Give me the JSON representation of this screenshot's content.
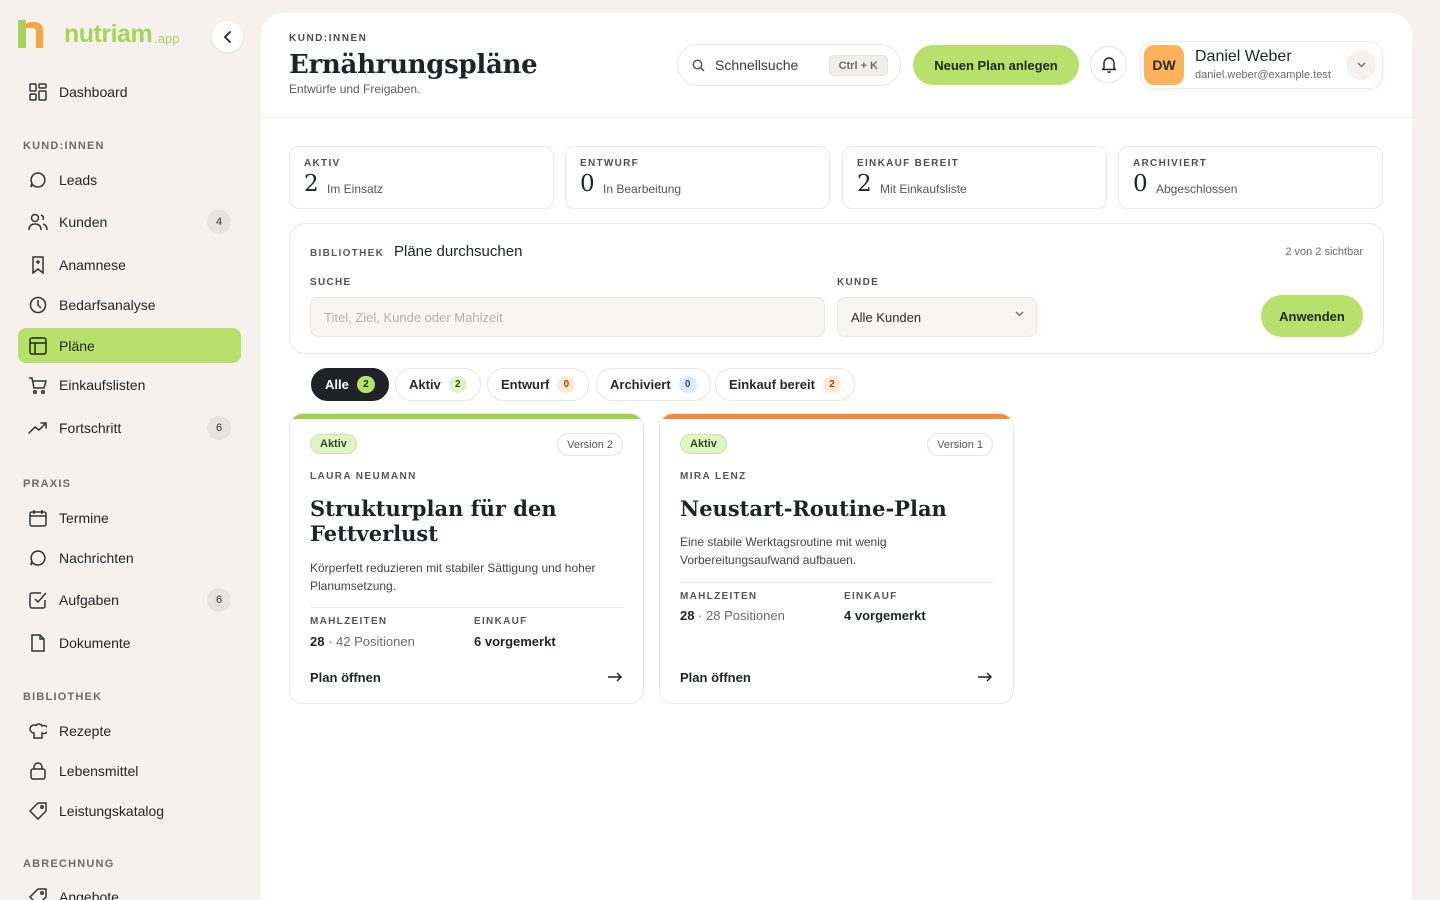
{
  "app": {
    "logo_text": "nutriam",
    "logo_suffix": ".app"
  },
  "sidebar": {
    "dashboard": "Dashboard",
    "sections": {
      "clients": "KUND:INNEN",
      "practice": "PRAXIS",
      "library": "BIBLIOTHEK",
      "billing": "ABRECHNUNG"
    },
    "items": [
      {
        "label": "Leads"
      },
      {
        "label": "Kunden",
        "badge": "4"
      },
      {
        "label": "Anamnese"
      },
      {
        "label": "Bedarfsanalyse"
      },
      {
        "label": "Pläne"
      },
      {
        "label": "Einkaufslisten"
      },
      {
        "label": "Fortschritt",
        "badge": "6"
      },
      {
        "label": "Termine"
      },
      {
        "label": "Nachrichten"
      },
      {
        "label": "Aufgaben",
        "badge": "6"
      },
      {
        "label": "Dokumente"
      },
      {
        "label": "Rezepte"
      },
      {
        "label": "Lebensmittel"
      },
      {
        "label": "Leistungskatalog"
      },
      {
        "label": "Angebote"
      }
    ]
  },
  "header": {
    "eyebrow": "KUND:INNEN",
    "title": "Ernährungspläne",
    "subtitle": "Entwürfe und Freigaben.",
    "search_label": "Schnellsuche",
    "shortcut": "Ctrl + K",
    "new_plan": "Neuen Plan anlegen",
    "user": {
      "initials": "DW",
      "name": "Daniel Weber",
      "email": "daniel.weber@example.test"
    }
  },
  "stats": [
    {
      "label": "AKTIV",
      "value": "2",
      "desc": "Im Einsatz"
    },
    {
      "label": "ENTWURF",
      "value": "0",
      "desc": "In Bearbeitung"
    },
    {
      "label": "EINKAUF BEREIT",
      "value": "2",
      "desc": "Mit Einkaufsliste"
    },
    {
      "label": "ARCHIVIERT",
      "value": "0",
      "desc": "Abgeschlossen"
    }
  ],
  "filter": {
    "eyebrow": "BIBLIOTHEK",
    "title": "Pläne durchsuchen",
    "count": "2 von 2 sichtbar",
    "search_label": "SUCHE",
    "search_placeholder": "Titel, Ziel, Kunde oder Mahlzeit",
    "client_label": "KUNDE",
    "client_value": "Alle Kunden",
    "apply": "Anwenden"
  },
  "tabs": [
    {
      "label": "Alle",
      "count": "2"
    },
    {
      "label": "Aktiv",
      "count": "2"
    },
    {
      "label": "Entwurf",
      "count": "0"
    },
    {
      "label": "Archiviert",
      "count": "0"
    },
    {
      "label": "Einkauf bereit",
      "count": "2"
    }
  ],
  "colors": {
    "accent": "#b8e06d",
    "card1_bar": "#9cd24a",
    "card2_bar": "#f58a3c"
  },
  "plans": [
    {
      "status": "Aktiv",
      "version": "Version 2",
      "client": "LAURA NEUMANN",
      "title": "Strukturplan für den Fettverlust",
      "desc": "Körperfett reduzieren mit stabiler Sättigung und hoher Planumsetzung.",
      "meals_label": "MAHLZEITEN",
      "meals": "28",
      "meals_extra": "· 42 Positionen",
      "shop_label": "EINKAUF",
      "shop": "6 vorgemerkt",
      "open": "Plan öffnen"
    },
    {
      "status": "Aktiv",
      "version": "Version 1",
      "client": "MIRA LENZ",
      "title": "Neustart-Routine-Plan",
      "desc": "Eine stabile Werktagsroutine mit wenig Vorbereitungsaufwand aufbauen.",
      "meals_label": "MAHLZEITEN",
      "meals": "28",
      "meals_extra": "· 28 Positionen",
      "shop_label": "EINKAUF",
      "shop": "4 vorgemerkt",
      "open": "Plan öffnen"
    }
  ]
}
